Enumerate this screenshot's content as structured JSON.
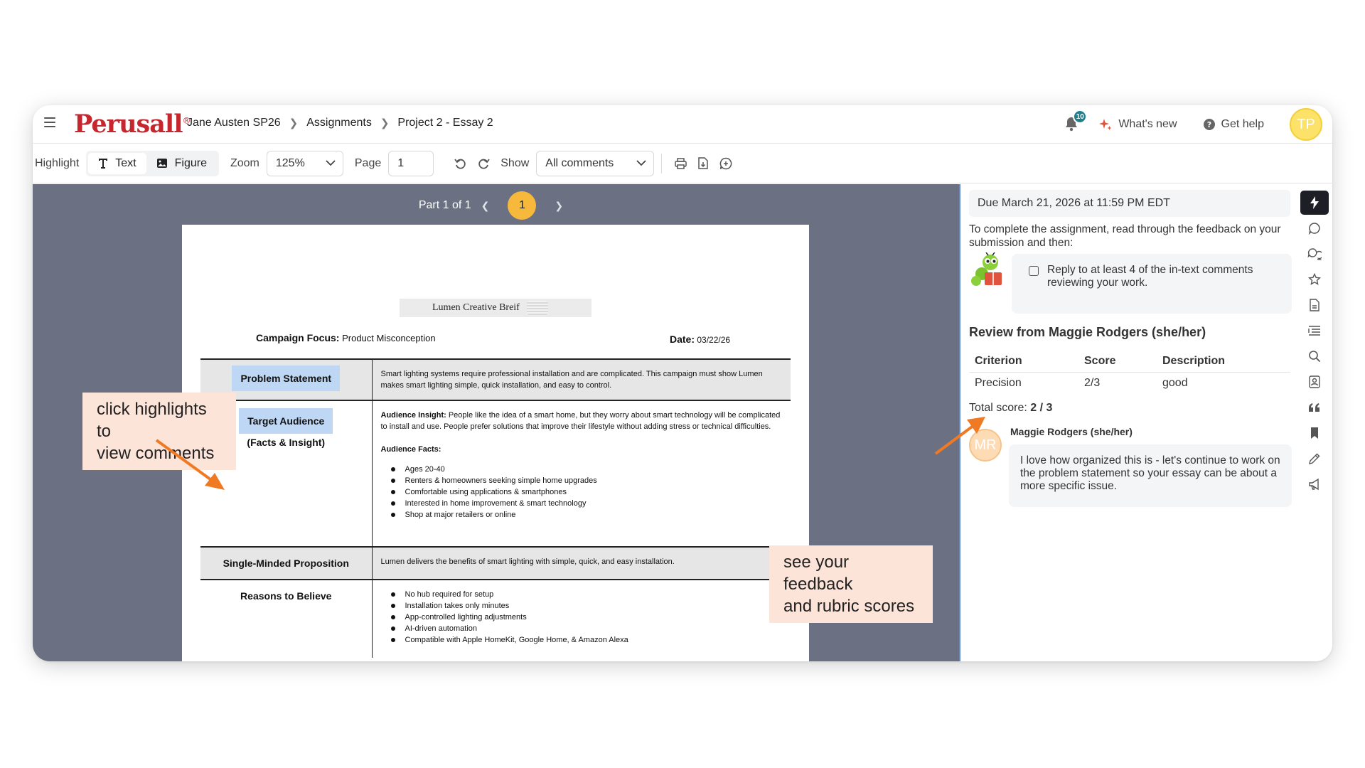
{
  "header": {
    "logo": "Perusall",
    "logo_mark": "®",
    "breadcrumb": [
      "Jane Austen SP26",
      "Assignments",
      "Project 2 - Essay 2"
    ],
    "notifications_count": "10",
    "whats_new": "What's new",
    "get_help": "Get help",
    "user_initials": "TP"
  },
  "toolbar": {
    "highlight_label": "Highlight",
    "text_btn": "Text",
    "figure_btn": "Figure",
    "zoom_label": "Zoom",
    "zoom_value": "125%",
    "page_label": "Page",
    "page_value": "1",
    "show_label": "Show",
    "show_value": "All comments"
  },
  "viewer": {
    "part_label": "Part 1 of 1",
    "current_part": "1"
  },
  "document": {
    "title": "Lumen Creative Breif",
    "campaign_focus_label": "Campaign Focus:",
    "campaign_focus_value": "Product Misconception",
    "date_label": "Date:",
    "date_value": "03/22/26",
    "rows": {
      "problem_label": "Problem Statement",
      "problem_text": "Smart lighting systems require professional installation and are complicated. This campaign must show Lumen makes smart lighting simple, quick installation, and easy to control.",
      "audience_label": "Target Audience",
      "audience_sub": "(Facts & Insight)",
      "insight_label": "Audience Insight:",
      "insight_text": " People like the idea of a smart home, but they worry about smart technology will be complicated to install and use. People prefer solutions that improve their lifestyle without adding stress or technical difficulties.",
      "facts_label": "Audience Facts:",
      "facts": [
        "Ages 20-40",
        "Renters & homeowners seeking simple home upgrades",
        "Comfortable using applications & smartphones",
        "Interested in home improvement & smart technology",
        "Shop at major retailers or online"
      ],
      "smp_label": "Single-Minded Proposition",
      "smp_text": "Lumen delivers the benefits of smart lighting with simple, quick, and easy installation.",
      "rtb_label": "Reasons to Believe",
      "rtb": [
        "No hub required for setup",
        "Installation takes only minutes",
        "App-controlled lighting adjustments",
        "AI-driven automation",
        "Compatible with Apple HomeKit, Google Home, & Amazon Alexa"
      ]
    }
  },
  "callouts": {
    "left": [
      "click highlights to",
      "view comments"
    ],
    "right": [
      "see your feedback",
      "and rubric scores"
    ]
  },
  "panel": {
    "due": "Due March 21, 2026 at 11:59 PM EDT",
    "instructions": "To complete the assignment, read through the feedback on your submission and then:",
    "task": "Reply to at least 4 of the in-text comments reviewing your work.",
    "review_title": "Review from Maggie Rodgers (she/her)",
    "rubric_headers": [
      "Criterion",
      "Score",
      "Description"
    ],
    "rubric_row": [
      "Precision",
      "2/3",
      "good"
    ],
    "total_label": "Total score: ",
    "total_value": "2 / 3",
    "comment_author": "Maggie Rodgers (she/her)",
    "comment_initials": "MR",
    "comment_text": "I love how organized this is - let's continue to work on the problem statement so your essay can be about a more specific issue."
  },
  "colors": {
    "brand": "#c6262e",
    "accent_orange": "#f6b93b",
    "callout_bg": "#fde4d9",
    "arrow": "#f07a23",
    "highlight": "#bdd7f4",
    "viewer_bg": "#6b7182"
  }
}
